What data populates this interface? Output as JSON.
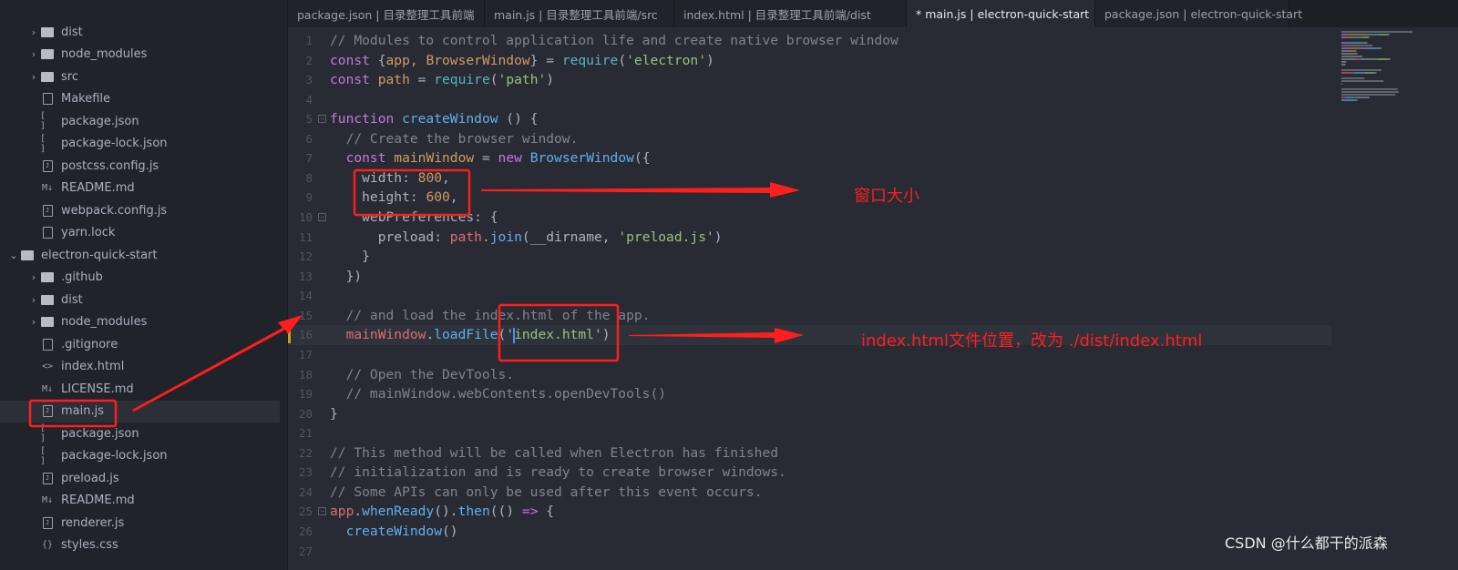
{
  "sidebar": {
    "items": [
      {
        "label": "dist",
        "type": "folder",
        "depth": 1,
        "expanded": false
      },
      {
        "label": "node_modules",
        "type": "folder",
        "depth": 1,
        "expanded": false
      },
      {
        "label": "src",
        "type": "folder",
        "depth": 1,
        "expanded": false
      },
      {
        "label": "Makefile",
        "type": "file",
        "depth": 1
      },
      {
        "label": "package.json",
        "type": "json",
        "depth": 1
      },
      {
        "label": "package-lock.json",
        "type": "json",
        "depth": 1
      },
      {
        "label": "postcss.config.js",
        "type": "js",
        "depth": 1
      },
      {
        "label": "README.md",
        "type": "md",
        "depth": 1
      },
      {
        "label": "webpack.config.js",
        "type": "js",
        "depth": 1
      },
      {
        "label": "yarn.lock",
        "type": "file",
        "depth": 1
      },
      {
        "label": "electron-quick-start",
        "type": "project",
        "depth": 0,
        "expanded": true
      },
      {
        "label": ".github",
        "type": "folder",
        "depth": 1,
        "expanded": false
      },
      {
        "label": "dist",
        "type": "folder",
        "depth": 1,
        "expanded": false
      },
      {
        "label": "node_modules",
        "type": "folder",
        "depth": 1,
        "expanded": false
      },
      {
        "label": ".gitignore",
        "type": "file",
        "depth": 1
      },
      {
        "label": "index.html",
        "type": "html",
        "depth": 1
      },
      {
        "label": "LICENSE.md",
        "type": "md",
        "depth": 1
      },
      {
        "label": "main.js",
        "type": "js",
        "depth": 1,
        "selected": true
      },
      {
        "label": "package.json",
        "type": "json",
        "depth": 1
      },
      {
        "label": "package-lock.json",
        "type": "json",
        "depth": 1
      },
      {
        "label": "preload.js",
        "type": "js",
        "depth": 1
      },
      {
        "label": "README.md",
        "type": "md",
        "depth": 1
      },
      {
        "label": "renderer.js",
        "type": "js",
        "depth": 1
      },
      {
        "label": "styles.css",
        "type": "css",
        "depth": 1
      }
    ]
  },
  "tabs": [
    {
      "label": "package.json | 目录整理工具前端",
      "active": false
    },
    {
      "label": "main.js | 目录整理工具前端/src",
      "active": false
    },
    {
      "label": "index.html | 目录整理工具前端/dist",
      "active": false
    },
    {
      "label": "* main.js | electron-quick-start",
      "active": true
    },
    {
      "label": "package.json | electron-quick-start",
      "active": false
    }
  ],
  "editor": {
    "current_line": 16,
    "lines": [
      [
        [
          "// Modules to control application life and create native browser window",
          "c"
        ]
      ],
      [
        [
          "const ",
          "k"
        ],
        [
          "{",
          "p"
        ],
        [
          "app, BrowserWindow",
          "v"
        ],
        [
          "} = ",
          "p"
        ],
        [
          "require",
          "t"
        ],
        [
          "(",
          "p"
        ],
        [
          "'electron'",
          "s"
        ],
        [
          ")",
          "p"
        ]
      ],
      [
        [
          "const ",
          "k"
        ],
        [
          "path",
          "v"
        ],
        [
          " = ",
          "p"
        ],
        [
          "require",
          "t"
        ],
        [
          "(",
          "p"
        ],
        [
          "'path'",
          "s"
        ],
        [
          ")",
          "p"
        ]
      ],
      [],
      [
        [
          "function ",
          "k"
        ],
        [
          "createWindow",
          "f"
        ],
        [
          " () {",
          "p"
        ]
      ],
      [
        [
          "  // Create the browser window.",
          "c"
        ]
      ],
      [
        [
          "  const ",
          "k"
        ],
        [
          "mainWindow",
          "v"
        ],
        [
          " = ",
          "p"
        ],
        [
          "new ",
          "k"
        ],
        [
          "BrowserWindow",
          "f"
        ],
        [
          "({",
          "p"
        ]
      ],
      [
        [
          "    width: ",
          "p"
        ],
        [
          "800",
          "n"
        ],
        [
          ",",
          "p"
        ]
      ],
      [
        [
          "    height: ",
          "p"
        ],
        [
          "600",
          "n"
        ],
        [
          ",",
          "p"
        ]
      ],
      [
        [
          "    webPreferences: {",
          "p"
        ]
      ],
      [
        [
          "      preload: ",
          "p"
        ],
        [
          "path",
          "r"
        ],
        [
          ".",
          "p"
        ],
        [
          "join",
          "f"
        ],
        [
          "(__dirname, ",
          "p"
        ],
        [
          "'preload.js'",
          "s"
        ],
        [
          ")",
          "p"
        ]
      ],
      [
        [
          "    }",
          "p"
        ]
      ],
      [
        [
          "  })",
          "p"
        ]
      ],
      [],
      [
        [
          "  // and load the index.html of the app.",
          "c"
        ]
      ],
      [
        [
          "  mainWindow",
          "r"
        ],
        [
          ".",
          "p"
        ],
        [
          "loadFile",
          "f"
        ],
        [
          "('",
          "p"
        ],
        [
          "index.html",
          "s"
        ],
        [
          "')",
          "p"
        ]
      ],
      [],
      [
        [
          "  // Open the DevTools.",
          "c"
        ]
      ],
      [
        [
          "  // mainWindow.webContents.openDevTools()",
          "c"
        ]
      ],
      [
        [
          "}",
          "p"
        ]
      ],
      [],
      [
        [
          "// This method will be called when Electron has finished",
          "c"
        ]
      ],
      [
        [
          "// initialization and is ready to create browser windows.",
          "c"
        ]
      ],
      [
        [
          "// Some APIs can only be used after this event occurs.",
          "c"
        ]
      ],
      [
        [
          "app",
          "r"
        ],
        [
          ".",
          "p"
        ],
        [
          "whenReady",
          "f"
        ],
        [
          "().",
          "p"
        ],
        [
          "then",
          "f"
        ],
        [
          "(() ",
          "p"
        ],
        [
          "=>",
          "k"
        ],
        [
          " {",
          "p"
        ]
      ],
      [
        [
          "  createWindow",
          "f"
        ],
        [
          "()",
          "p"
        ]
      ],
      []
    ]
  },
  "annotations": {
    "window_size_note": "窗口大小",
    "index_note": "index.html文件位置，改为 ./dist/index.html",
    "color": "#ff1e1e"
  },
  "watermark": "CSDN @什么都干的派森"
}
